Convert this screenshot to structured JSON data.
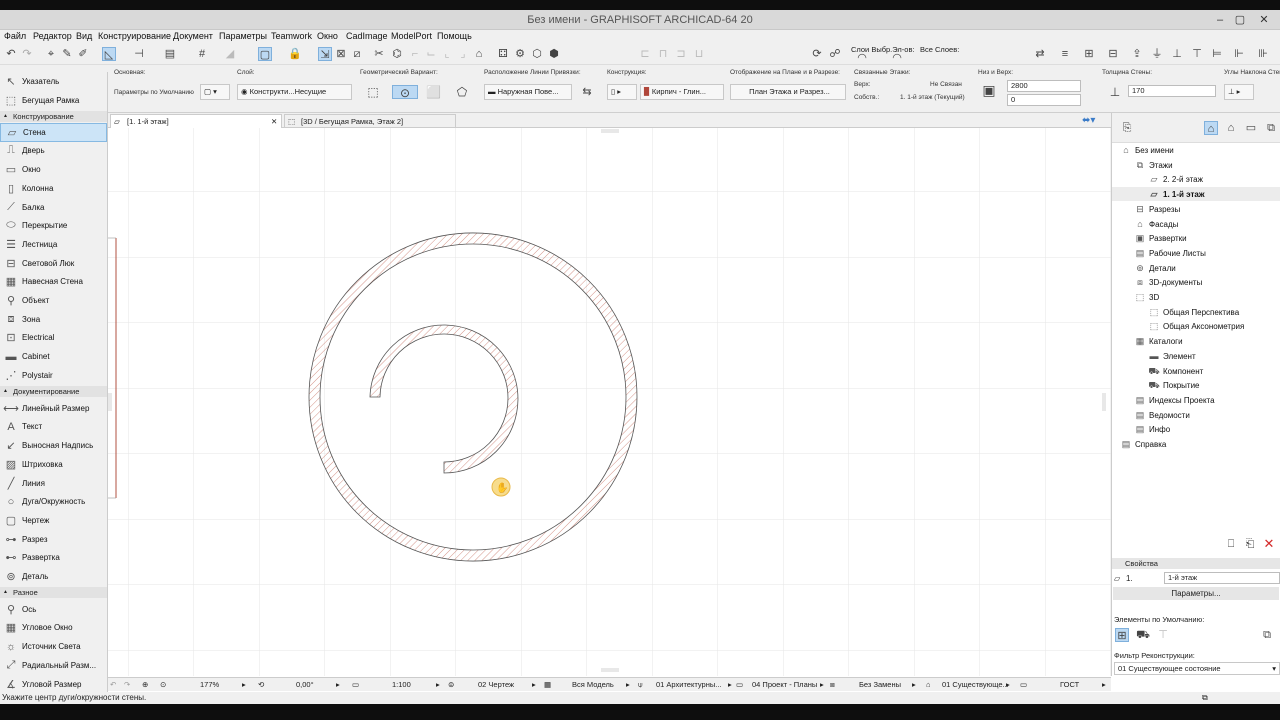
{
  "window": {
    "title": "Без имени - GRAPHISOFT ARCHICAD-64 20",
    "minimize": "–",
    "maximize": "▢",
    "close": "✕"
  },
  "menu": [
    "Файл",
    "Редактор",
    "Вид",
    "Конструирование",
    "Документ",
    "Параметры",
    "Teamwork",
    "Окно",
    "CadImage",
    "ModelPort",
    "Помощь"
  ],
  "toolbar_right": {
    "sel_layers": "Слои Выбр.Эл-ов:",
    "all_layers": "Все Слоев:"
  },
  "infobox": {
    "main_label": "Основная:",
    "main_value": "Параметры по Умолчанию",
    "layer_label": "Слой:",
    "layer_value": "Конструкти...Несущие",
    "geom_label": "Геометрический Вариант:",
    "refline_label": "Расположение Линии Привязки:",
    "refline_value": "Наружная Пове...",
    "struct_label": "Конструкция:",
    "struct_value": "Кирпич - Глин...",
    "display_label": "Отображение на Плане и в Разрезе:",
    "display_value": "План Этажа и Разрез...",
    "linked_label": "Связанные Этажи:",
    "top_label": "Верх:",
    "top_value": "Не Связан",
    "own_label": "Собств.:",
    "own_value": "1. 1-й этаж (Текущий)",
    "height_label": "Низ и Верх:",
    "height_value": "2800",
    "offset_value": "0",
    "thick_label": "Толщина Стены:",
    "thick_value": "170",
    "slant_label": "Углы Наклона Стены:"
  },
  "toolbox": {
    "pointer": "Указатель",
    "marquee": "Бегущая Рамка",
    "section_design": "Конструирование",
    "design_tools": [
      {
        "label": "Стена",
        "icon": "wall-icon"
      },
      {
        "label": "Дверь",
        "icon": "door-icon"
      },
      {
        "label": "Окно",
        "icon": "window-icon"
      },
      {
        "label": "Колонна",
        "icon": "column-icon"
      },
      {
        "label": "Балка",
        "icon": "beam-icon"
      },
      {
        "label": "Перекрытие",
        "icon": "slab-icon"
      },
      {
        "label": "Лестница",
        "icon": "stair-icon"
      },
      {
        "label": "Световой Люк",
        "icon": "skylight-icon"
      },
      {
        "label": "Навесная Стена",
        "icon": "curtain-wall-icon"
      },
      {
        "label": "Объект",
        "icon": "object-icon"
      },
      {
        "label": "Зона",
        "icon": "zone-icon"
      },
      {
        "label": "Electrical",
        "icon": "electrical-icon"
      },
      {
        "label": "Cabinet",
        "icon": "cabinet-icon"
      },
      {
        "label": "Polystair",
        "icon": "polystair-icon"
      }
    ],
    "section_doc": "Документирование",
    "doc_tools": [
      {
        "label": "Линейный Размер",
        "icon": "dimension-icon"
      },
      {
        "label": "Текст",
        "icon": "text-icon"
      },
      {
        "label": "Выносная Надпись",
        "icon": "label-icon"
      },
      {
        "label": "Штриховка",
        "icon": "fill-icon"
      },
      {
        "label": "Линия",
        "icon": "line-icon"
      },
      {
        "label": "Дуга/Окружность",
        "icon": "arc-icon"
      },
      {
        "label": "Чертеж",
        "icon": "drawing-icon"
      },
      {
        "label": "Разрез",
        "icon": "section-icon"
      },
      {
        "label": "Развертка",
        "icon": "elevation-icon"
      },
      {
        "label": "Деталь",
        "icon": "detail-icon"
      }
    ],
    "section_misc": "Разное",
    "misc_tools": [
      {
        "label": "Ось",
        "icon": "grid-axis-icon"
      },
      {
        "label": "Угловое Окно",
        "icon": "corner-window-icon"
      },
      {
        "label": "Источник Света",
        "icon": "lamp-icon"
      },
      {
        "label": "Радиальный Разм...",
        "icon": "radial-dimension-icon"
      },
      {
        "label": "Угловой Размер",
        "icon": "angle-dimension-icon"
      }
    ]
  },
  "tabs": [
    {
      "label": "[1. 1-й этаж]"
    },
    {
      "label": "[3D / Бегущая Рамка, Этаж 2]"
    }
  ],
  "navigator": {
    "items": [
      {
        "label": "Без имени",
        "icon": "project-icon",
        "level": 0,
        "cur": false
      },
      {
        "label": "Этажи",
        "icon": "stories-icon",
        "level": 1,
        "cur": false
      },
      {
        "label": "2. 2-й этаж",
        "icon": "story-icon",
        "level": 2,
        "cur": false
      },
      {
        "label": "1. 1-й этаж",
        "icon": "story-icon",
        "level": 2,
        "cur": true
      },
      {
        "label": "Разрезы",
        "icon": "sections-icon",
        "level": 1,
        "cur": false
      },
      {
        "label": "Фасады",
        "icon": "elevations-icon",
        "level": 1,
        "cur": false
      },
      {
        "label": "Развертки",
        "icon": "interior-elevations-icon",
        "level": 1,
        "cur": false
      },
      {
        "label": "Рабочие Листы",
        "icon": "worksheets-icon",
        "level": 1,
        "cur": false
      },
      {
        "label": "Детали",
        "icon": "details-icon",
        "level": 1,
        "cur": false
      },
      {
        "label": "3D-документы",
        "icon": "3d-documents-icon",
        "level": 1,
        "cur": false
      },
      {
        "label": "3D",
        "icon": "3d-icon",
        "level": 1,
        "cur": false
      },
      {
        "label": "Общая Перспектива",
        "icon": "perspective-icon",
        "level": 2,
        "cur": false
      },
      {
        "label": "Общая Аксонометрия",
        "icon": "axonometry-icon",
        "level": 2,
        "cur": false
      },
      {
        "label": "Каталоги",
        "icon": "schedules-icon",
        "level": 1,
        "cur": false
      },
      {
        "label": "Элемент",
        "icon": "element-icon",
        "level": 2,
        "cur": false
      },
      {
        "label": "Компонент",
        "icon": "component-icon",
        "level": 2,
        "cur": false
      },
      {
        "label": "Покрытие",
        "icon": "surface-icon",
        "level": 2,
        "cur": false
      },
      {
        "label": "Индексы Проекта",
        "icon": "project-indexes-icon",
        "level": 1,
        "cur": false
      },
      {
        "label": "Ведомости",
        "icon": "lists-icon",
        "level": 1,
        "cur": false
      },
      {
        "label": "Инфо",
        "icon": "info-icon",
        "level": 1,
        "cur": false
      },
      {
        "label": "Справка",
        "icon": "help-icon",
        "level": 0,
        "cur": false
      }
    ],
    "props_title": "Свойства",
    "props_num": "1.",
    "props_name": "1-й этаж",
    "params_btn": "Параметры...",
    "defaults_label": "Элементы по Умолчанию:",
    "filter_label": "Фильтр Реконструкции:",
    "filter_value": "01 Существующее состояние"
  },
  "status": {
    "zoom": "177%",
    "angle": "0,00°",
    "scale": "1:100",
    "layer_combo": "02 Чертеж",
    "model_view": "Вся Модель",
    "pen_set": "01 Архитектурны...",
    "dim": "04 Проект - Планы",
    "override": "Без Замены",
    "renovation": "01 Существующе...",
    "standard": "ГОСТ"
  },
  "status_text": "Укажите центр дуги/окружности стены."
}
